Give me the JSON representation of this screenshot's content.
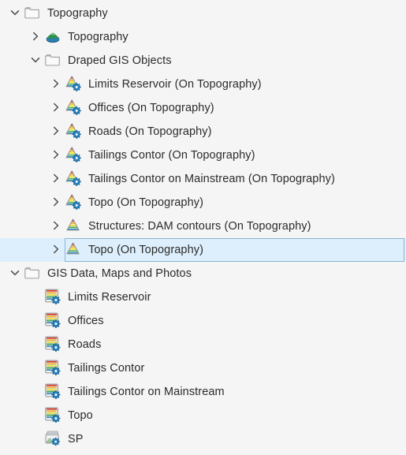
{
  "panel": {
    "name": "topography-tree-panel",
    "background_color": "#f5f5f5",
    "text_color": "#2b2b2b",
    "selection_fill": "#ddeffc",
    "selection_border": "#8ab4d4"
  },
  "rows": [
    {
      "label": "Topography",
      "depth": 0,
      "chevron": "down",
      "icon": "folder-icon",
      "selected": false
    },
    {
      "label": "Topography",
      "depth": 1,
      "chevron": "right",
      "icon": "terrain-icon",
      "selected": false
    },
    {
      "label": "Draped GIS Objects",
      "depth": 1,
      "chevron": "down",
      "icon": "folder-icon",
      "selected": false
    },
    {
      "label": "Limits Reservoir (On Topography)",
      "depth": 2,
      "chevron": "right",
      "icon": "contour-gear-icon",
      "selected": false
    },
    {
      "label": "Offices (On Topography)",
      "depth": 2,
      "chevron": "right",
      "icon": "contour-gear-icon",
      "selected": false
    },
    {
      "label": "Roads (On Topography)",
      "depth": 2,
      "chevron": "right",
      "icon": "contour-gear-icon",
      "selected": false
    },
    {
      "label": "Tailings Contor (On Topography)",
      "depth": 2,
      "chevron": "right",
      "icon": "contour-gear-icon",
      "selected": false
    },
    {
      "label": "Tailings Contor on Mainstream (On Topography)",
      "depth": 2,
      "chevron": "right",
      "icon": "contour-gear-icon",
      "selected": false
    },
    {
      "label": "Topo (On Topography)",
      "depth": 2,
      "chevron": "right",
      "icon": "contour-gear-icon",
      "selected": false
    },
    {
      "label": "Structures: DAM contours (On Topography)",
      "depth": 2,
      "chevron": "right",
      "icon": "contour-icon",
      "selected": false
    },
    {
      "label": "Topo (On Topography)",
      "depth": 2,
      "chevron": "right",
      "icon": "contour-icon",
      "selected": true
    },
    {
      "label": "GIS Data, Maps and Photos",
      "depth": 0,
      "chevron": "down",
      "icon": "folder-icon",
      "selected": false
    },
    {
      "label": "Limits Reservoir",
      "depth": 1,
      "chevron": "none",
      "icon": "layers-gear-icon",
      "selected": false
    },
    {
      "label": "Offices",
      "depth": 1,
      "chevron": "none",
      "icon": "layers-gear-icon",
      "selected": false
    },
    {
      "label": "Roads",
      "depth": 1,
      "chevron": "none",
      "icon": "layers-gear-icon",
      "selected": false
    },
    {
      "label": "Tailings Contor",
      "depth": 1,
      "chevron": "none",
      "icon": "layers-gear-icon",
      "selected": false
    },
    {
      "label": "Tailings Contor on Mainstream",
      "depth": 1,
      "chevron": "none",
      "icon": "layers-gear-icon",
      "selected": false
    },
    {
      "label": "Topo",
      "depth": 1,
      "chevron": "none",
      "icon": "layers-gear-icon",
      "selected": false
    },
    {
      "label": "SP",
      "depth": 1,
      "chevron": "none",
      "icon": "photo-stack-icon",
      "selected": false
    }
  ]
}
